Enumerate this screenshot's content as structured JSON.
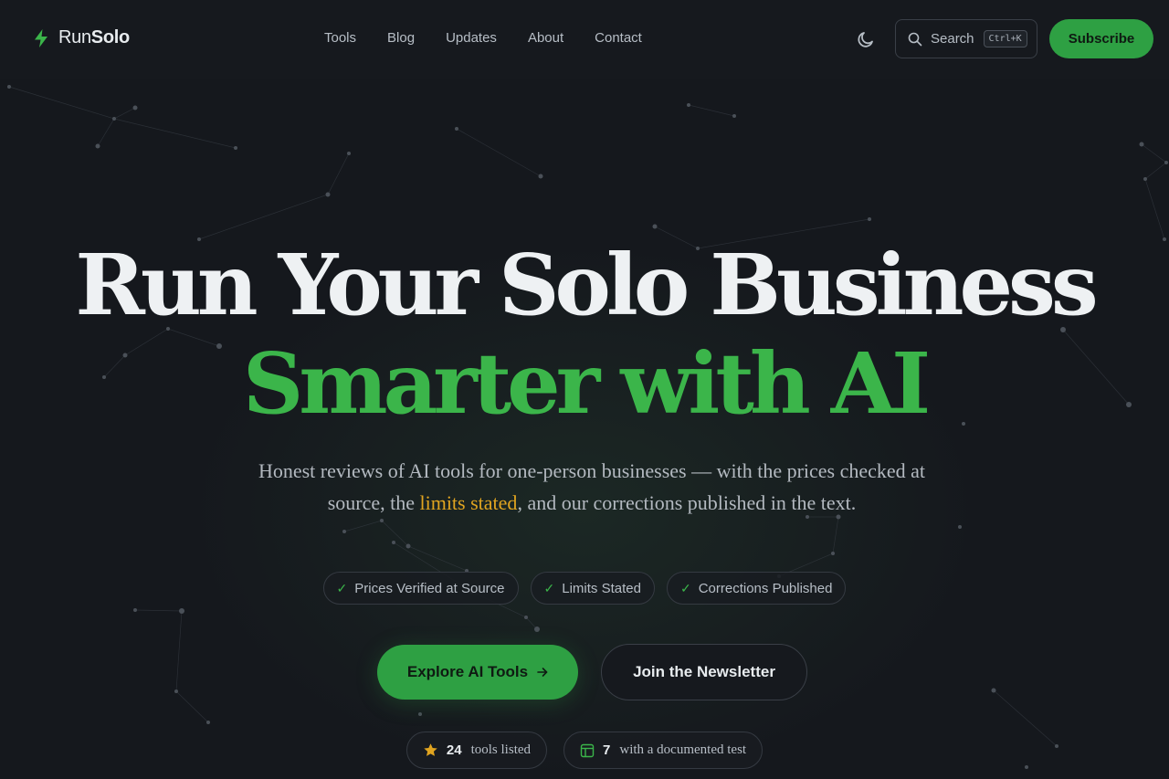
{
  "brand": {
    "name_light": "Run",
    "name_bold": "Solo"
  },
  "nav": {
    "items": [
      "Tools",
      "Blog",
      "Updates",
      "About",
      "Contact"
    ]
  },
  "header": {
    "search_label": "Search",
    "search_shortcut": "Ctrl+K",
    "subscribe_label": "Subscribe"
  },
  "hero": {
    "headline_line1": "Run Your Solo Business",
    "headline_line2": "Smarter with AI",
    "subtitle_before": "Honest reviews of AI tools for one-person businesses — with the prices checked at source, the ",
    "subtitle_highlight": "limits stated",
    "subtitle_after": ", and our corrections published in the text.",
    "badges": [
      "Prices Verified at Source",
      "Limits Stated",
      "Corrections Published"
    ],
    "cta_primary": "Explore AI Tools",
    "cta_secondary": "Join the Newsletter",
    "stats": [
      {
        "icon": "star-icon",
        "value": "24",
        "label": "tools listed"
      },
      {
        "icon": "table-icon",
        "value": "7",
        "label": "with a documented test"
      }
    ]
  },
  "colors": {
    "background": "#15181d",
    "accent": "#2ea043",
    "accent_text": "#3bb54a",
    "highlight": "#e0a420"
  }
}
